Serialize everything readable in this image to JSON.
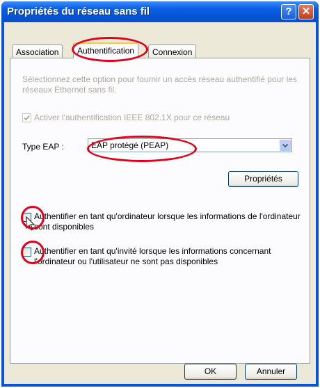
{
  "window": {
    "title": "Propriétés du réseau sans fil",
    "help_glyph": "?",
    "close_glyph": "✕"
  },
  "tabs": [
    {
      "label": "Association",
      "active": false
    },
    {
      "label": "Authentification",
      "active": true
    },
    {
      "label": "Connexion",
      "active": false
    }
  ],
  "panel": {
    "description": "Sélectionnez cette option pour fournir un accès réseau authentifié pour les réseaux Ethernet sans fil.",
    "enable_8021x_label": "Activer l'authentification IEEE 802.1X pour ce réseau",
    "enable_8021x_checked": true,
    "eap_type_label": "Type EAP :",
    "eap_type_value": "EAP protégé (PEAP)",
    "properties_button": "Propriétés",
    "computer_auth_label": "Authentifier en tant qu'ordinateur lorsque les informations de l'ordinateur sont disponibles",
    "computer_auth_checked": false,
    "guest_auth_label": "Authentifier en tant qu'invité lorsque les informations concernant l'ordinateur ou l'utilisateur ne sont pas disponibles",
    "guest_auth_checked": false
  },
  "footer": {
    "ok_button": "OK",
    "cancel_button": "Annuler"
  },
  "colors": {
    "titlebar": "#0554d4",
    "annotation_red": "#e3001b",
    "dialog_background": "#ece9d8"
  },
  "icons": [
    "help-icon",
    "close-icon",
    "dropdown-arrow-icon",
    "checkmark-icon",
    "mouse-cursor-icon"
  ]
}
